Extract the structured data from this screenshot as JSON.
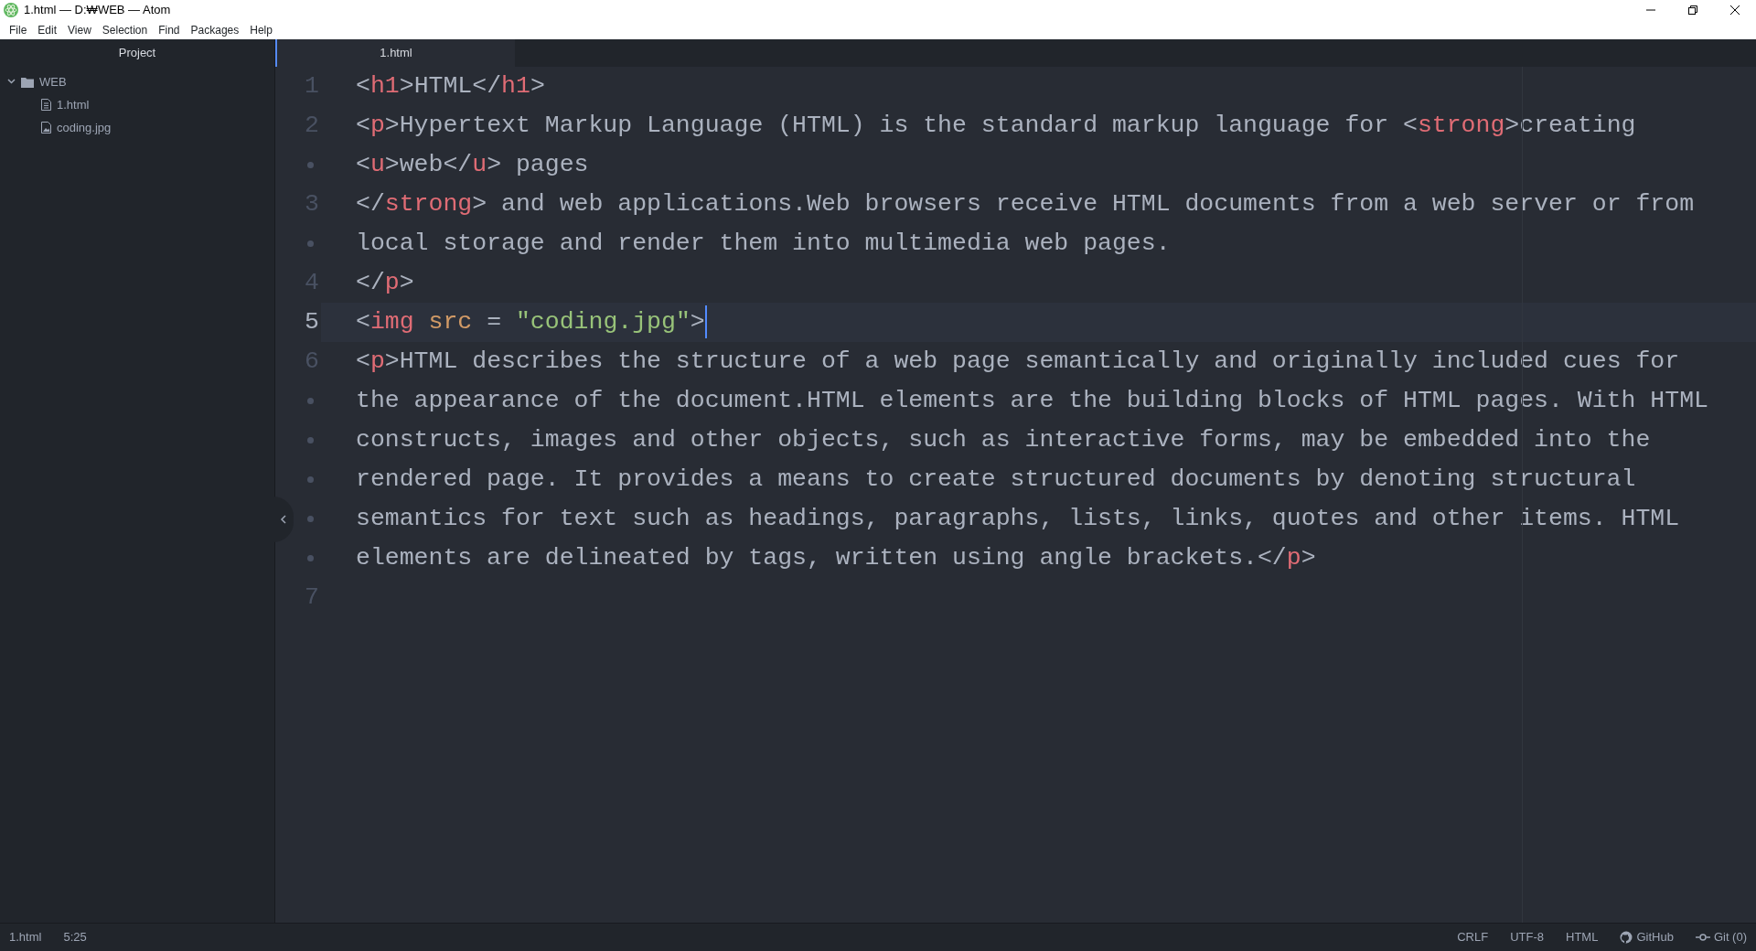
{
  "window": {
    "title": "1.html — D:₩WEB — Atom"
  },
  "menu": [
    "File",
    "Edit",
    "View",
    "Selection",
    "Find",
    "Packages",
    "Help"
  ],
  "sidebar": {
    "title": "Project",
    "tree": [
      {
        "label": "WEB",
        "kind": "folder",
        "expanded": true,
        "children": [
          {
            "label": "1.html",
            "kind": "text"
          },
          {
            "label": "coding.jpg",
            "kind": "image"
          }
        ]
      }
    ]
  },
  "tabs": [
    {
      "label": "1.html",
      "selected": true
    }
  ],
  "editor": {
    "lines": [
      {
        "number": "1",
        "current": false,
        "rows": [
          {
            "segments": [
              {
                "kind": "punct",
                "text": "<"
              },
              {
                "kind": "tag",
                "text": "h1"
              },
              {
                "kind": "punct",
                "text": ">"
              },
              {
                "kind": "plain",
                "text": "HTML"
              },
              {
                "kind": "punct",
                "text": "</"
              },
              {
                "kind": "tag",
                "text": "h1"
              },
              {
                "kind": "punct",
                "text": ">"
              }
            ]
          }
        ]
      },
      {
        "number": "2",
        "current": false,
        "rows": [
          {
            "segments": [
              {
                "kind": "punct",
                "text": "<"
              },
              {
                "kind": "tag",
                "text": "p"
              },
              {
                "kind": "punct",
                "text": ">"
              },
              {
                "kind": "plain",
                "text": "Hypertext Markup Language (HTML) is the standard markup language for "
              },
              {
                "kind": "punct",
                "text": "<"
              },
              {
                "kind": "tag",
                "text": "strong"
              },
              {
                "kind": "punct",
                "text": ">"
              },
              {
                "kind": "plain",
                "text": "creating"
              }
            ]
          },
          {
            "segments": [
              {
                "kind": "punct",
                "text": "<"
              },
              {
                "kind": "tag",
                "text": "u"
              },
              {
                "kind": "punct",
                "text": ">"
              },
              {
                "kind": "plain",
                "text": "web"
              },
              {
                "kind": "punct",
                "text": "</"
              },
              {
                "kind": "tag",
                "text": "u"
              },
              {
                "kind": "punct",
                "text": ">"
              },
              {
                "kind": "plain",
                "text": " pages"
              }
            ]
          }
        ]
      },
      {
        "number": "3",
        "current": false,
        "rows": [
          {
            "segments": [
              {
                "kind": "punct",
                "text": "</"
              },
              {
                "kind": "tag",
                "text": "strong"
              },
              {
                "kind": "punct",
                "text": ">"
              },
              {
                "kind": "plain",
                "text": " and web applications.Web browsers receive HTML documents from a web server or from"
              }
            ]
          },
          {
            "segments": [
              {
                "kind": "plain",
                "text": "local storage and render them into multimedia web pages."
              }
            ]
          }
        ]
      },
      {
        "number": "4",
        "current": false,
        "rows": [
          {
            "segments": [
              {
                "kind": "punct",
                "text": "</"
              },
              {
                "kind": "tag",
                "text": "p"
              },
              {
                "kind": "punct",
                "text": ">"
              }
            ]
          }
        ]
      },
      {
        "number": "5",
        "current": true,
        "rows": [
          {
            "segments": [
              {
                "kind": "punct",
                "text": "<"
              },
              {
                "kind": "tag",
                "text": "img"
              },
              {
                "kind": "attr",
                "text": " src"
              },
              {
                "kind": "plain",
                "text": " = "
              },
              {
                "kind": "string",
                "text": "\"coding.jpg\""
              },
              {
                "kind": "punct",
                "text": ">"
              }
            ]
          }
        ]
      },
      {
        "number": "6",
        "current": false,
        "rows": [
          {
            "segments": [
              {
                "kind": "punct",
                "text": "<"
              },
              {
                "kind": "tag",
                "text": "p"
              },
              {
                "kind": "punct",
                "text": ">"
              },
              {
                "kind": "plain",
                "text": "HTML describes the structure of a web page semantically and originally included cues for"
              }
            ]
          },
          {
            "segments": [
              {
                "kind": "plain",
                "text": "the appearance of the document.HTML elements are the building blocks of HTML pages. With HTML"
              }
            ]
          },
          {
            "segments": [
              {
                "kind": "plain",
                "text": "constructs, images and other objects, such as interactive forms, may be embedded into the"
              }
            ]
          },
          {
            "segments": [
              {
                "kind": "plain",
                "text": "rendered page. It provides a means to create structured documents by denoting structural"
              }
            ]
          },
          {
            "segments": [
              {
                "kind": "plain",
                "text": "semantics for text such as headings, paragraphs, lists, links, quotes and other items. HTML"
              }
            ]
          },
          {
            "segments": [
              {
                "kind": "plain",
                "text": "elements are delineated by tags, written using angle brackets."
              },
              {
                "kind": "punct",
                "text": "</"
              },
              {
                "kind": "tag",
                "text": "p"
              },
              {
                "kind": "punct",
                "text": ">"
              }
            ]
          }
        ]
      },
      {
        "number": "7",
        "current": false,
        "rows": [
          {
            "segments": []
          }
        ]
      }
    ]
  },
  "status_bar": {
    "file": "1.html",
    "position": "5:25",
    "line_ending": "CRLF",
    "encoding": "UTF-8",
    "grammar": "HTML",
    "github": "GitHub",
    "git": "Git (0)"
  }
}
